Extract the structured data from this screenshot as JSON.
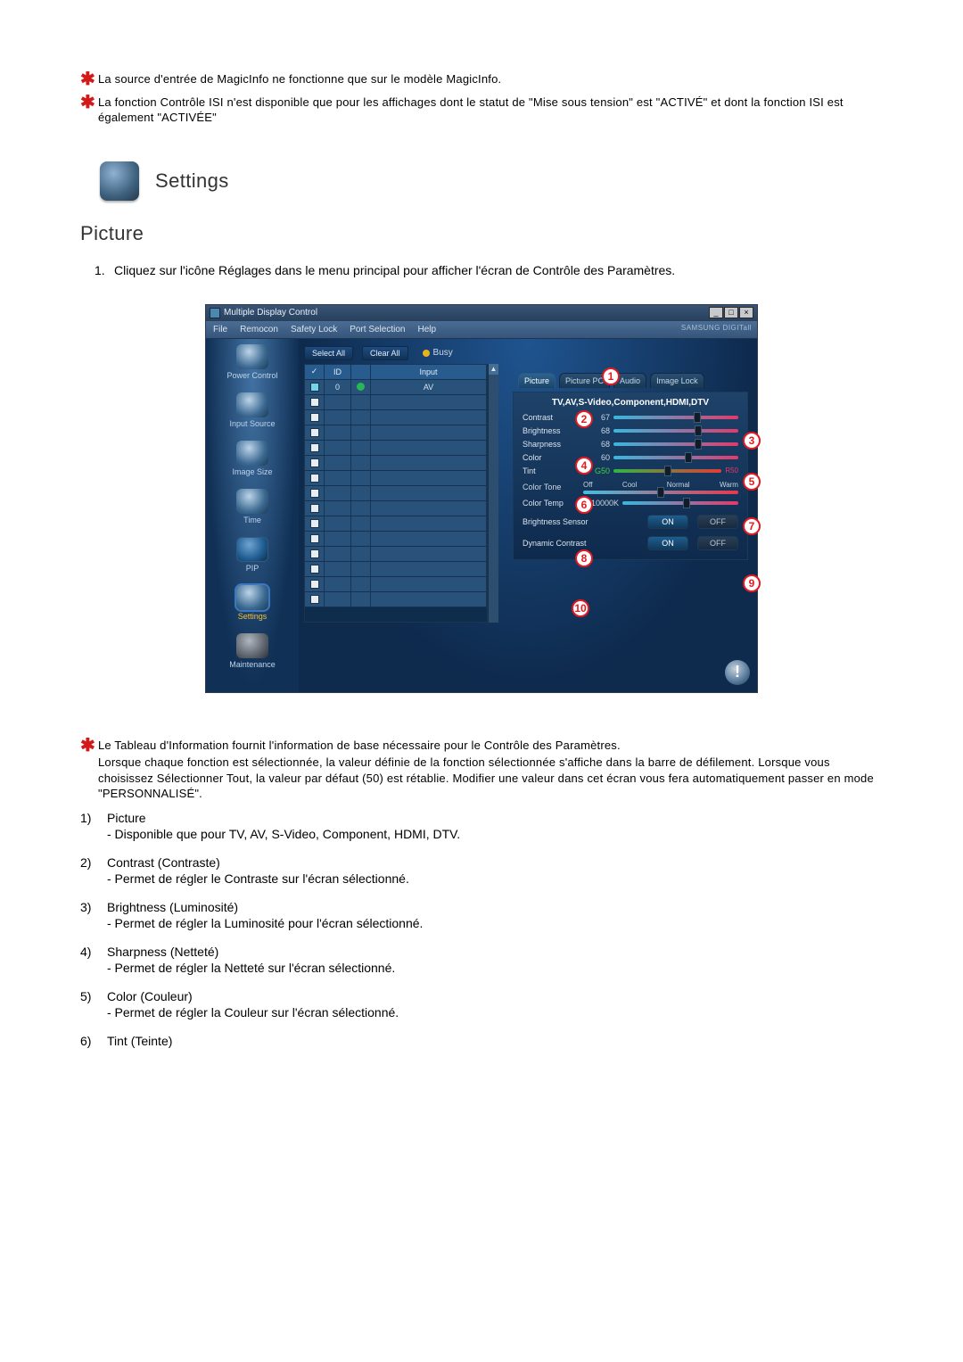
{
  "notes": {
    "n1": "La source d'entrée de MagicInfo ne fonctionne que sur le modèle MagicInfo.",
    "n2": "La fonction Contrôle ISI n'est disponible que pour les affichages dont le statut de \"Mise sous tension\" est \"ACTIVÉ\" et dont la fonction ISI est également \"ACTIVÉE\""
  },
  "heading": "Settings",
  "subheading": "Picture",
  "intro": {
    "num": "1.",
    "text": "Cliquez sur l'icône Réglages dans le menu principal pour afficher l'écran de Contrôle des Paramètres."
  },
  "app": {
    "title": "Multiple Display Control",
    "menu": {
      "file": "File",
      "remocon": "Remocon",
      "safety": "Safety Lock",
      "port": "Port Selection",
      "help": "Help"
    },
    "brand": "SAMSUNG DIGITall",
    "sidebar": {
      "power": "Power Control",
      "input": "Input Source",
      "image": "Image Size",
      "time": "Time",
      "pip": "PIP",
      "settings": "Settings",
      "maintenance": "Maintenance"
    },
    "toolbar": {
      "selectAll": "Select All",
      "clearAll": "Clear All",
      "busy": "Busy"
    },
    "list": {
      "head": {
        "chk": "✓",
        "id": "ID",
        "status": "",
        "input": "Input"
      },
      "row1": {
        "id": "0",
        "input": "AV"
      }
    },
    "tabs": {
      "picture": "Picture",
      "picturePc": "Picture PC",
      "audio": "Audio",
      "imageLock": "Image Lock"
    },
    "panel": {
      "header": "TV,AV,S-Video,Component,HDMI,DTV",
      "contrast": {
        "label": "Contrast",
        "value": "67"
      },
      "brightness": {
        "label": "Brightness",
        "value": "68"
      },
      "sharpness": {
        "label": "Sharpness",
        "value": "68"
      },
      "color": {
        "label": "Color",
        "value": "60"
      },
      "tint": {
        "label": "Tint",
        "value": "G50",
        "end": "R50"
      },
      "colorTone": {
        "label": "Color Tone",
        "off": "Off",
        "cool": "Cool",
        "normal": "Normal",
        "warm": "Warm"
      },
      "colorTemp": {
        "label": "Color Temp",
        "value": "10000K"
      },
      "brightnessSensor": {
        "label": "Brightness Sensor",
        "on": "ON",
        "off": "OFF"
      },
      "dynamicContrast": {
        "label": "Dynamic Contrast",
        "on": "ON",
        "off": "OFF"
      }
    }
  },
  "markers": {
    "m1": "1",
    "m3": "3",
    "m4": "4",
    "m5": "5",
    "m6": "6",
    "m7": "7",
    "m8": "8",
    "m9": "9",
    "m10": "10",
    "mA": "2"
  },
  "after": {
    "star": "Le Tableau d'Information fournit l'information de base nécessaire pour le Contrôle des Paramètres.",
    "para": "Lorsque chaque fonction est sélectionnée, la valeur définie de la fonction sélectionnée s'affiche dans la barre de défilement. Lorsque vous choisissez Sélectionner Tout, la valeur par défaut (50) est rétablie. Modifier une valeur dans cet écran vous fera automatiquement passer en mode \"PERSONNALISÉ\"."
  },
  "defs": [
    {
      "num": "1)",
      "title": "Picture",
      "desc": "- Disponible que pour TV, AV, S-Video, Component, HDMI, DTV."
    },
    {
      "num": "2)",
      "title": "Contrast (Contraste)",
      "desc": "- Permet de régler le Contraste sur l'écran sélectionné."
    },
    {
      "num": "3)",
      "title": "Brightness (Luminosité)",
      "desc": "- Permet de régler la Luminosité pour l'écran sélectionné."
    },
    {
      "num": "4)",
      "title": "Sharpness (Netteté)",
      "desc": "- Permet de régler la Netteté sur l'écran sélectionné."
    },
    {
      "num": "5)",
      "title": "Color (Couleur)",
      "desc": "- Permet de régler la Couleur sur l'écran sélectionné."
    },
    {
      "num": "6)",
      "title": "Tint (Teinte)",
      "desc": ""
    }
  ]
}
